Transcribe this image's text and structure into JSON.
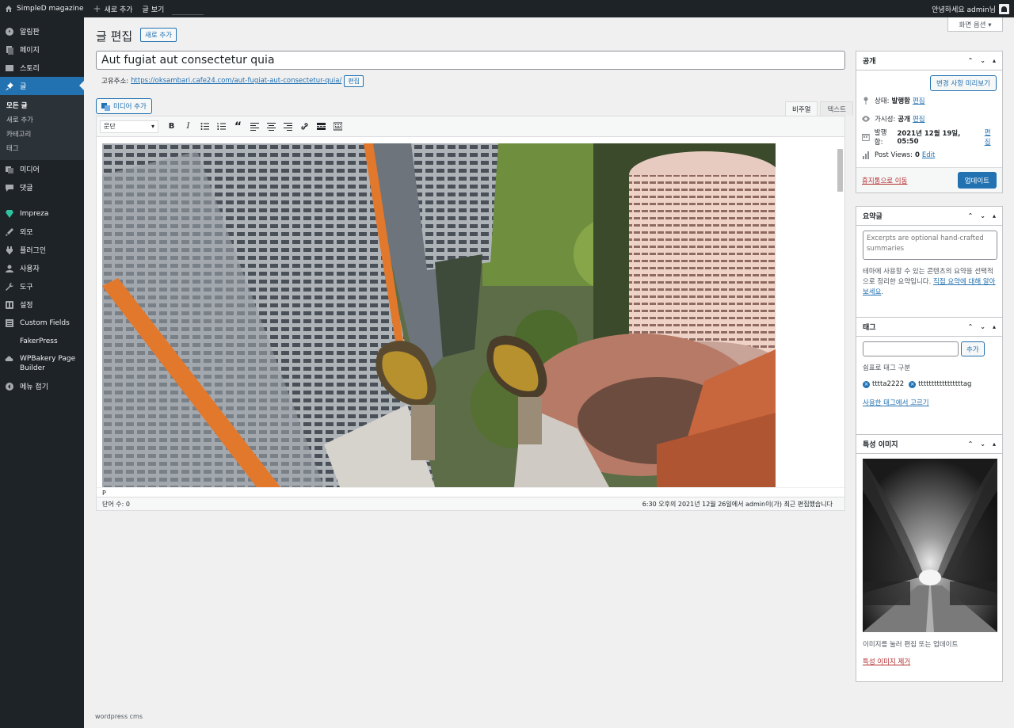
{
  "adminbar": {
    "site_name": "SimpleD magazine",
    "new_label": "새로 추가",
    "view_post": "글 보기",
    "greeting": "안녕하세요 admin님"
  },
  "sidebar": {
    "items": [
      {
        "label": "알림판",
        "icon": "dashboard-icon"
      },
      {
        "label": "페이지",
        "icon": "pages-icon"
      },
      {
        "label": "스토리",
        "icon": "stories-icon"
      },
      {
        "label": "글",
        "icon": "pin-icon"
      },
      {
        "label": "미디어",
        "icon": "media-icon"
      },
      {
        "label": "댓글",
        "icon": "comments-icon"
      },
      {
        "label": "Impreza",
        "icon": "impreza-icon"
      },
      {
        "label": "외모",
        "icon": "appearance-icon"
      },
      {
        "label": "플러그인",
        "icon": "plugins-icon"
      },
      {
        "label": "사용자",
        "icon": "users-icon"
      },
      {
        "label": "도구",
        "icon": "tools-icon"
      },
      {
        "label": "설정",
        "icon": "settings-icon"
      },
      {
        "label": "Custom Fields",
        "icon": "custom-fields-icon"
      },
      {
        "label": "FakerPress",
        "icon": ""
      },
      {
        "label": "WPBakery Page Builder",
        "icon": "wpbakery-icon"
      },
      {
        "label": "메뉴 접기",
        "icon": "collapse-icon"
      }
    ],
    "submenu": [
      "모든 글",
      "새로 추가",
      "카테고리",
      "태그"
    ]
  },
  "header": {
    "screen_options": "화면 옵션 ▾",
    "title": "글 편집",
    "add_new": "새로 추가"
  },
  "post": {
    "title": "Aut fugiat aut consectetur quia",
    "permalink_label": "고유주소:",
    "permalink_url": "https://oksambari.cafe24.com/aut-fugiat-aut-consectetur-quia/",
    "permalink_edit": "편집"
  },
  "editor": {
    "add_media": "미디어 추가",
    "tab_visual": "비주얼",
    "tab_text": "텍스트",
    "format_select": "문단",
    "path": "P",
    "word_count": "단어 수: 0",
    "last_edited": "6:30 오후의 2021년 12월 26일에서 admin이(가) 최근 편집했습니다"
  },
  "publish_box": {
    "title": "공개",
    "preview_button": "변경 사항 미리보기",
    "status_label": "상태:",
    "status_value": "발행함",
    "visibility_label": "가시성:",
    "visibility_value": "공개",
    "published_label": "발행함:",
    "published_value": "2021년 12월 19일, 05:50",
    "views_label": "Post Views:",
    "views_value": "0",
    "edit_link": "편집",
    "edit_link_en": "Edit",
    "trash": "휴지통으로 이동",
    "update": "업데이트"
  },
  "excerpt_box": {
    "title": "요약글",
    "placeholder": "Excerpts are optional hand-crafted summaries",
    "hint_text": "테마에 사용할 수 있는 콘텐츠의 요약을 선택적으로 정리한 요약입니다. ",
    "hint_link": "직접 요약에 대해 알아보세요",
    "hint_end": "."
  },
  "tags_box": {
    "title": "태그",
    "add_button": "추가",
    "hint": "쉼표로 태그 구분",
    "tags": [
      "tttta2222",
      "tttttttttttttttttag"
    ],
    "choose_link": "사용한 태그에서 고르기"
  },
  "featured_box": {
    "title": "특성 이미지",
    "hint": "이미지를 눌러 편집 또는 업데이트",
    "remove": "특성 이미지 제거"
  },
  "footer": {
    "text": "wordpress cms"
  },
  "colors": {
    "accent": "#2271b1",
    "adminbar": "#1d2327",
    "danger": "#b32d2e"
  }
}
